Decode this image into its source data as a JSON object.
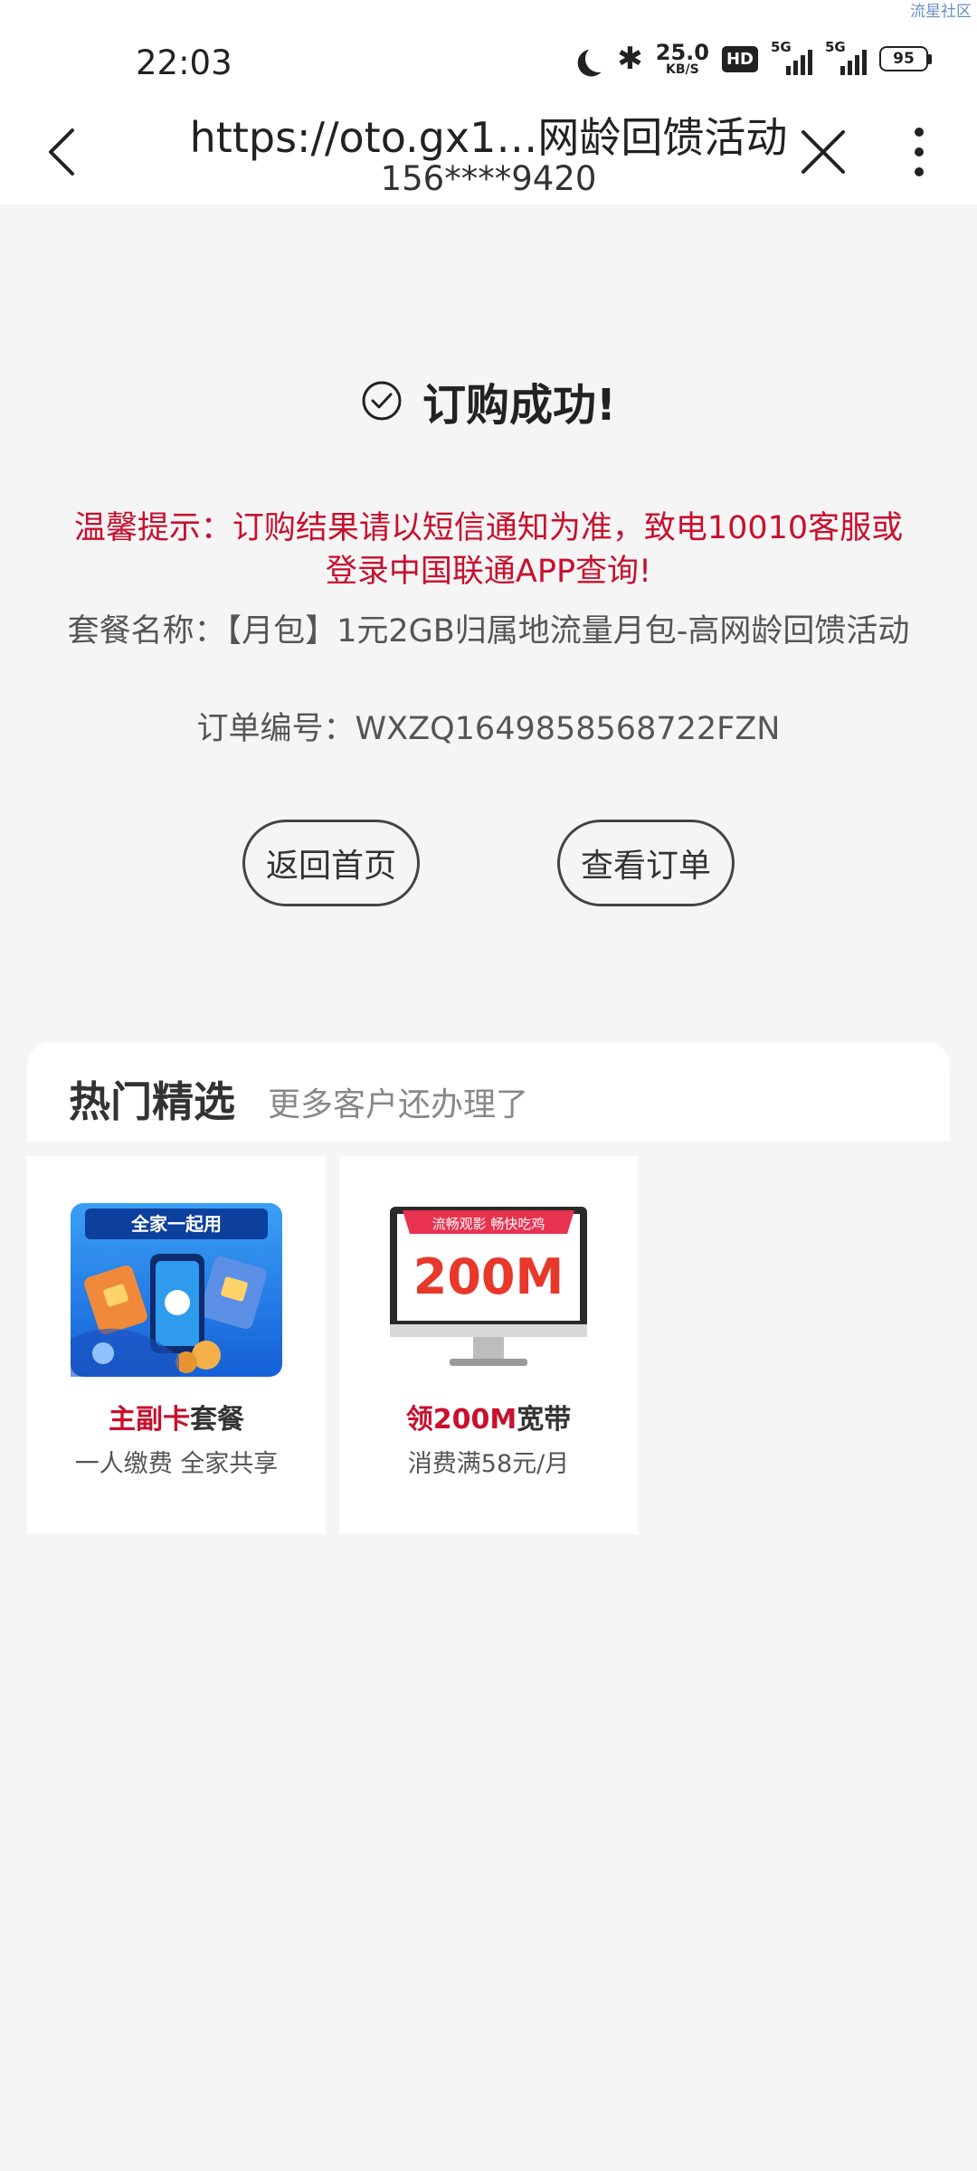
{
  "status_bar": {
    "time": "22:03",
    "speed_value": "25.0",
    "speed_unit": "KB/S",
    "hd_label": "HD",
    "signal1_label": "5G",
    "signal2_label": "5G",
    "battery": "95",
    "watermark": "流星社区"
  },
  "browser": {
    "url": "https://oto.gx1…网龄回馈活动",
    "phone": "156****9420"
  },
  "result": {
    "title": "订购成功!",
    "notice": "温馨提示：订购结果请以短信通知为准，致电10010客服或登录中国联通APP查询!",
    "package": "套餐名称：【月包】1元2GB归属地流量月包-高网龄回馈活动",
    "order": "订单编号：WXZQ1649858568722FZN"
  },
  "buttons": {
    "home": "返回首页",
    "orders": "查看订单"
  },
  "hot": {
    "title": "热门精选",
    "subtitle": "更多客户还办理了",
    "cards": [
      {
        "image_banner": "全家一起用",
        "title_highlight": "主副卡",
        "title_rest": "套餐",
        "desc": "一人缴费 全家共享"
      },
      {
        "image_banner": "流畅观影 畅快吃鸡",
        "image_text": "200M",
        "title_highlight": "领200M",
        "title_rest": "宽带",
        "desc": "消费满58元/月"
      }
    ]
  },
  "colors": {
    "accent_red": "#c8102e",
    "background": "#f5f5f5"
  }
}
